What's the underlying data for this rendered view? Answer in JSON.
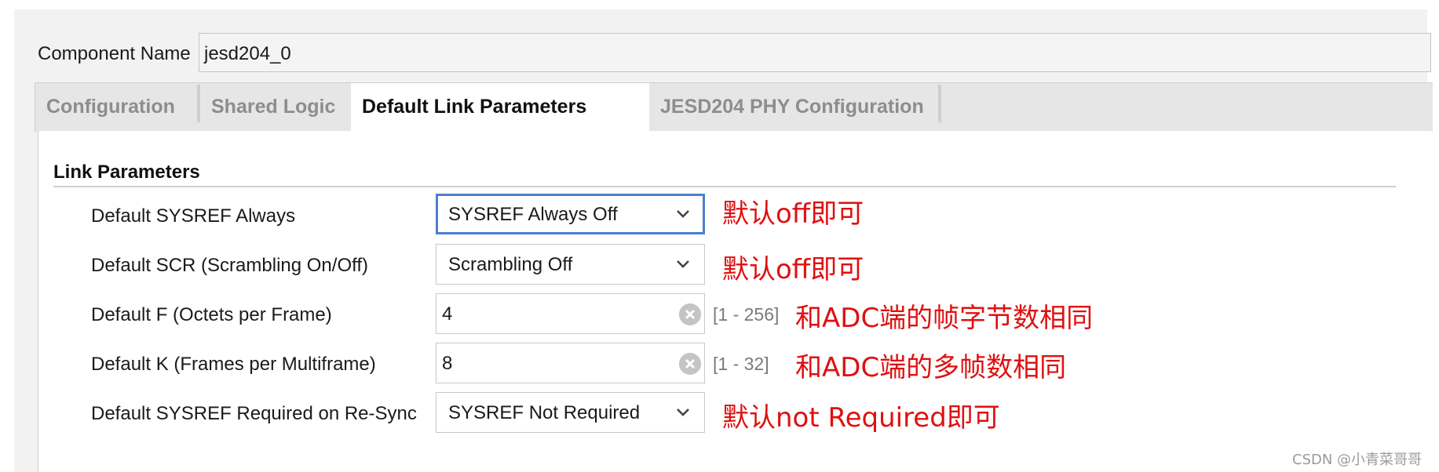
{
  "component": {
    "label": "Component Name",
    "value": "jesd204_0"
  },
  "tabs": [
    {
      "label": "Configuration",
      "active": false
    },
    {
      "label": "Shared Logic",
      "active": false
    },
    {
      "label": "Default Link Parameters",
      "active": true
    },
    {
      "label": "JESD204 PHY Configuration",
      "active": false
    }
  ],
  "section": {
    "title": "Link Parameters"
  },
  "params": [
    {
      "label": "Default SYSREF Always",
      "value": "SYSREF Always Off",
      "type": "dropdown"
    },
    {
      "label": "Default SCR (Scrambling On/Off)",
      "value": "Scrambling Off",
      "type": "dropdown"
    },
    {
      "label": "Default F (Octets per Frame)",
      "value": "4",
      "type": "spin",
      "range": "[1 - 256]"
    },
    {
      "label": "Default K (Frames per Multiframe)",
      "value": "8",
      "type": "spin",
      "range": "[1 - 32]"
    },
    {
      "label": "Default SYSREF Required on Re-Sync",
      "value": "SYSREF Not Required",
      "type": "dropdown"
    }
  ],
  "annotations": [
    "默认off即可",
    "默认off即可",
    "和ADC端的帧字节数相同",
    "和ADC端的多帧数相同",
    "默认not Required即可"
  ],
  "watermark": "CSDN @小青菜哥哥",
  "colors": {
    "focus_border": "#4a7fd1",
    "annotation": "#e01010"
  },
  "icons": {
    "dropdown": "chevron-down-icon",
    "clear": "clear-icon"
  }
}
